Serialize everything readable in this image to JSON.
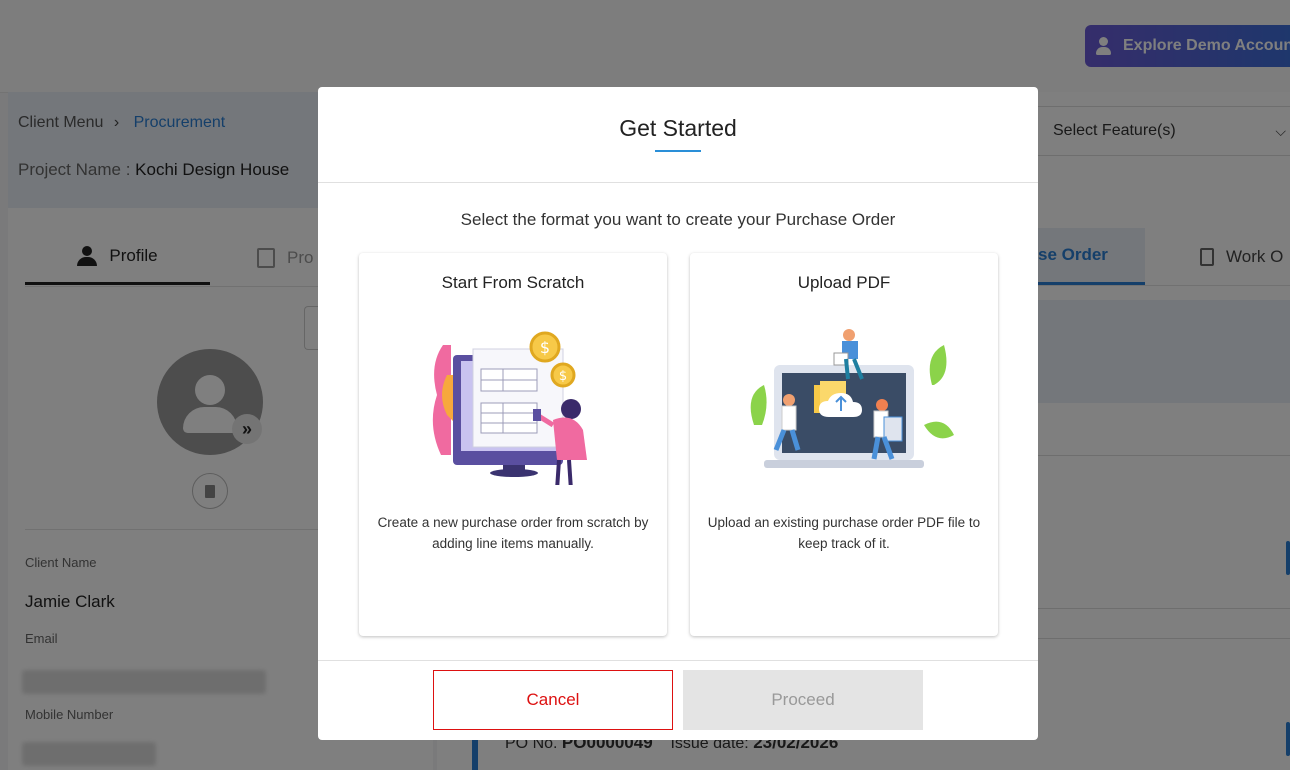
{
  "header": {
    "demo_button": "Explore Demo Account"
  },
  "breadcrumb": {
    "root": "Client Menu",
    "current": "Procurement"
  },
  "project": {
    "label": "Project Name :",
    "name": "Kochi Design House"
  },
  "left_tabs": {
    "profile": "Profile",
    "second": "Pro"
  },
  "client": {
    "name_label": "Client Name",
    "name": "Jamie Clark",
    "email_label": "Email",
    "mobile_label": "Mobile Number"
  },
  "feature_select": {
    "value": "Select Feature(s)"
  },
  "right_tabs": {
    "purchase_order": "se Order",
    "work_order": "Work O"
  },
  "po_row": {
    "po_label": "PO No.",
    "po_value": "PO0000049",
    "date_label": "Issue date:",
    "date_value": "23/02/2026"
  },
  "modal": {
    "title": "Get Started",
    "subtitle": "Select the format you want to create your Purchase Order",
    "options": [
      {
        "title": "Start From Scratch",
        "description": "Create a new purchase order from scratch by adding line items manually."
      },
      {
        "title": "Upload PDF",
        "description": "Upload an existing purchase order PDF file to keep track of it."
      }
    ],
    "cancel": "Cancel",
    "proceed": "Proceed"
  },
  "colors": {
    "accent": "#2a7fd4",
    "danger": "#dd1111",
    "disabled_bg": "#e4e4e4"
  }
}
